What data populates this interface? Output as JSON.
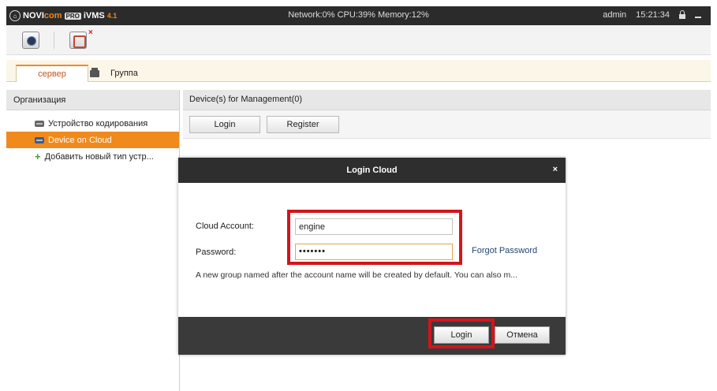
{
  "app": {
    "brand_prefix": "NOVI",
    "brand_highlight": "com",
    "brand_pro": "PRO",
    "product": "iVMS",
    "version": "4.1",
    "status": "Network:0% CPU:39% Memory:12%",
    "user": "admin",
    "time": "15:21:34",
    "accent_color": "#f08a1c"
  },
  "toolbar": {
    "close_mark": "×"
  },
  "tabs": {
    "server_label": "сервер",
    "group_label": "Группа"
  },
  "left_panel": {
    "header": "Организация",
    "items": [
      {
        "label": "Устройство кодирования",
        "icon": "encoder-device-icon"
      },
      {
        "label": "Device on Cloud",
        "icon": "cloud-device-icon",
        "selected": true
      },
      {
        "label": "Добавить новый тип устр...",
        "icon": "plus-icon"
      }
    ]
  },
  "main": {
    "header": "Device(s) for Management(0)",
    "login_button": "Login",
    "register_button": "Register"
  },
  "dialog": {
    "title": "Login Cloud",
    "close": "×",
    "account_label": "Cloud Account:",
    "account_value": "engine",
    "password_label": "Password:",
    "password_value": "•••••••",
    "forgot_link": "Forgot Password",
    "hint": "A new group named after the account name will be created  by default. You can also m...",
    "login_button": "Login",
    "cancel_button": "Отмена",
    "highlight_color": "#d4141c"
  }
}
